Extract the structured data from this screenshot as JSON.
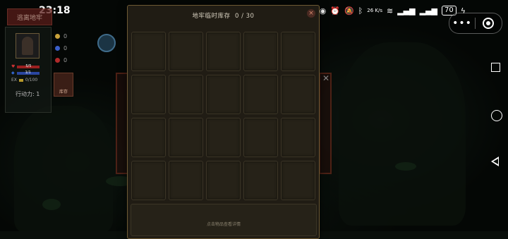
{
  "status_bar": {
    "time": "23:18",
    "net_speed": "26 K/s",
    "battery": "70"
  },
  "capsule": {
    "more_label": "•••"
  },
  "hud": {
    "escape_label": "逃离地牢",
    "hp": "5/5",
    "mp": "1/1",
    "ex_label": "EX",
    "ex": "0/100",
    "action_points": "行动力: 1",
    "gold": "0",
    "blue_gem": "0",
    "red_gem": "0",
    "bag_label": "库存"
  },
  "modal": {
    "title": "地牢临时库存",
    "count": "0 / 30",
    "close_label": "×",
    "slots_visible": 20,
    "detail_hint": "点击物品查看详情"
  },
  "colors": {
    "modal_bg": "#201c14",
    "modal_border": "#6e5a34",
    "slot_bg": "#262218"
  }
}
